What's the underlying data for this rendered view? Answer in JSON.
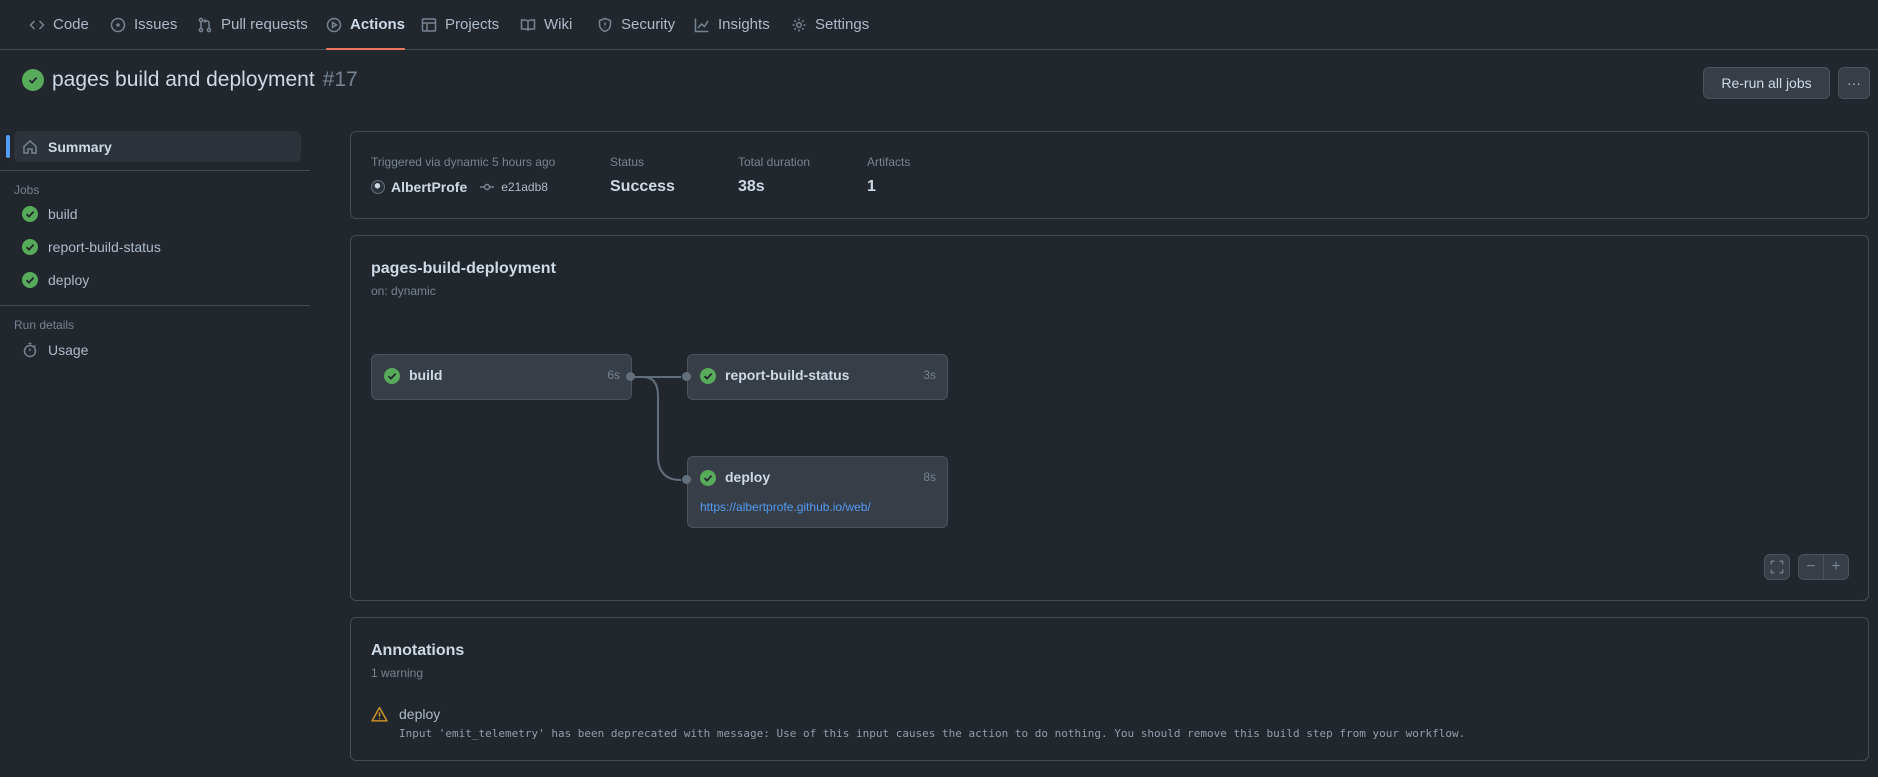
{
  "nav": {
    "tabs": [
      {
        "label": "Code",
        "icon": "code-icon"
      },
      {
        "label": "Issues",
        "icon": "issue-icon"
      },
      {
        "label": "Pull requests",
        "icon": "pull-request-icon"
      },
      {
        "label": "Actions",
        "icon": "play-icon"
      },
      {
        "label": "Projects",
        "icon": "table-icon"
      },
      {
        "label": "Wiki",
        "icon": "book-icon"
      },
      {
        "label": "Security",
        "icon": "shield-icon"
      },
      {
        "label": "Insights",
        "icon": "graph-icon"
      },
      {
        "label": "Settings",
        "icon": "gear-icon"
      }
    ],
    "active": "Actions"
  },
  "run": {
    "title": "pages build and deployment",
    "number": "#17",
    "rerun_label": "Re-run all jobs",
    "more_label": "···"
  },
  "sidebar": {
    "summary_label": "Summary",
    "jobs_heading": "Jobs",
    "jobs": [
      {
        "label": "build"
      },
      {
        "label": "report-build-status"
      },
      {
        "label": "deploy"
      }
    ],
    "run_details_heading": "Run details",
    "usage_label": "Usage"
  },
  "summary": {
    "trigger_label": "Triggered via dynamic 5 hours ago",
    "actor": "AlbertProfe",
    "commit": "e21adb8",
    "status_label": "Status",
    "status_value": "Success",
    "duration_label": "Total duration",
    "duration_value": "38s",
    "artifacts_label": "Artifacts",
    "artifacts_value": "1"
  },
  "workflow": {
    "name": "pages-build-deployment",
    "trigger": "on: dynamic",
    "jobs": [
      {
        "name": "build",
        "duration": "6s"
      },
      {
        "name": "report-build-status",
        "duration": "3s"
      },
      {
        "name": "deploy",
        "duration": "8s",
        "url": "https://albertprofe.github.io/web/"
      }
    ],
    "zoom_out_label": "−",
    "zoom_in_label": "+"
  },
  "annotations": {
    "title": "Annotations",
    "count_label": "1 warning",
    "items": [
      {
        "job": "deploy",
        "message": "Input 'emit_telemetry' has been deprecated with message: Use of this input causes the action to do nothing. You should remove this build step from your workflow."
      }
    ]
  },
  "colors": {
    "background": "#22272e",
    "success": "#57ab5a",
    "accent": "#ec775c",
    "link": "#539bf5",
    "warning": "#c69026"
  }
}
